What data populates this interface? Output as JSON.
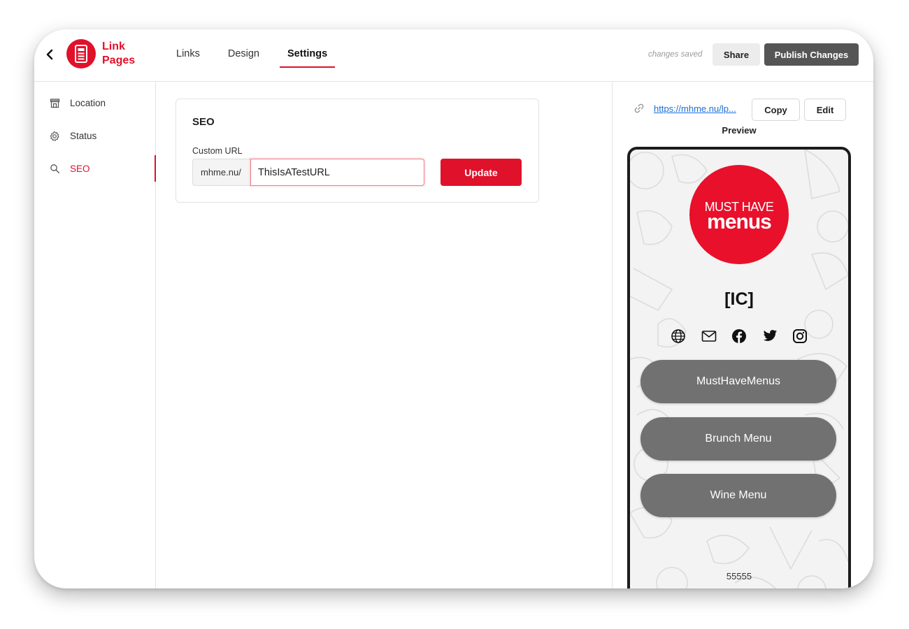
{
  "app": {
    "brand_line1": "Link",
    "brand_line2": "Pages"
  },
  "tabs": [
    {
      "label": "Links"
    },
    {
      "label": "Design"
    },
    {
      "label": "Settings",
      "active": true
    }
  ],
  "header": {
    "status_text": "changes saved",
    "share_label": "Share",
    "publish_label": "Publish Changes"
  },
  "sidebar": {
    "items": [
      {
        "label": "Location",
        "icon": "storefront-icon"
      },
      {
        "label": "Status",
        "icon": "gear-icon"
      },
      {
        "label": "SEO",
        "icon": "search-icon",
        "active": true
      }
    ]
  },
  "seo": {
    "title": "SEO",
    "custom_url_label": "Custom URL",
    "prefix": "mhme.nu/",
    "value": "ThisIsATestURL",
    "update_label": "Update"
  },
  "preview": {
    "url": "https://mhme.nu/lp...",
    "copy_label": "Copy",
    "edit_label": "Edit",
    "label": "Preview",
    "logo_top": "MUST HAVE",
    "logo_bottom": "menus",
    "restaurant_name": "[IC]",
    "social_icons": [
      "globe-icon",
      "mail-icon",
      "facebook-icon",
      "twitter-icon",
      "instagram-icon"
    ],
    "buttons": [
      {
        "label": "MustHaveMenus"
      },
      {
        "label": "Brunch Menu"
      },
      {
        "label": "Wine Menu"
      }
    ],
    "footer": "55555"
  },
  "colors": {
    "accent": "#e0112b",
    "publish_bg": "#555555",
    "menu_button": "#717171"
  }
}
